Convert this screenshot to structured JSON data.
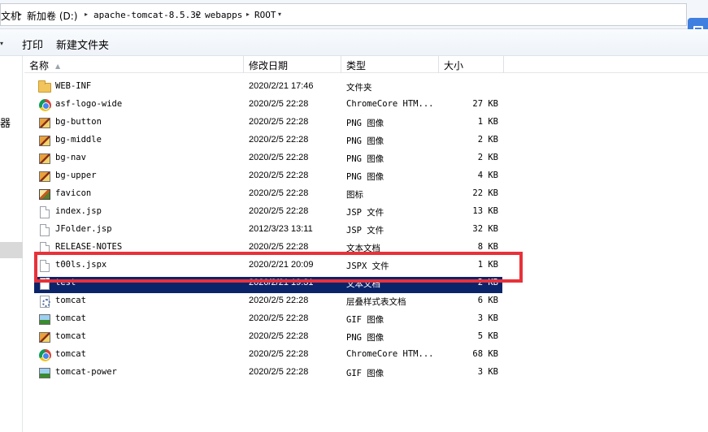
{
  "breadcrumb": {
    "items": [
      "文机",
      "新加卷 (D:)",
      "apache-tomcat-8.5.32",
      "webapps",
      "ROOT"
    ]
  },
  "toolbar": {
    "print_label": "打印",
    "new_folder_label": "新建文件夹"
  },
  "nav_pane": {
    "partial_char": "器"
  },
  "columns": {
    "name": "名称",
    "date": "修改日期",
    "type": "类型",
    "size": "大小"
  },
  "files": [
    {
      "name": "WEB-INF",
      "date": "2020/2/21 17:46",
      "type": "文件夹",
      "size": "",
      "icon": "folder-icon"
    },
    {
      "name": "asf-logo-wide",
      "date": "2020/2/5 22:28",
      "type": "ChromeCore HTM...",
      "size": "27 KB",
      "icon": "chrome-icon"
    },
    {
      "name": "bg-button",
      "date": "2020/2/5 22:28",
      "type": "PNG 图像",
      "size": "1 KB",
      "icon": "png-image-icon"
    },
    {
      "name": "bg-middle",
      "date": "2020/2/5 22:28",
      "type": "PNG 图像",
      "size": "2 KB",
      "icon": "png-image-icon"
    },
    {
      "name": "bg-nav",
      "date": "2020/2/5 22:28",
      "type": "PNG 图像",
      "size": "2 KB",
      "icon": "png-image-icon"
    },
    {
      "name": "bg-upper",
      "date": "2020/2/5 22:28",
      "type": "PNG 图像",
      "size": "4 KB",
      "icon": "png-image-icon"
    },
    {
      "name": "favicon",
      "date": "2020/2/5 22:28",
      "type": "图标",
      "size": "22 KB",
      "icon": "ico-icon"
    },
    {
      "name": "index.jsp",
      "date": "2020/2/5 22:28",
      "type": "JSP 文件",
      "size": "13 KB",
      "icon": "document-icon"
    },
    {
      "name": "JFolder.jsp",
      "date": "2012/3/23 13:11",
      "type": "JSP 文件",
      "size": "32 KB",
      "icon": "document-icon"
    },
    {
      "name": "RELEASE-NOTES",
      "date": "2020/2/5 22:28",
      "type": "文本文档",
      "size": "8 KB",
      "icon": "document-icon"
    },
    {
      "name": "t00ls.jspx",
      "date": "2020/2/21 20:09",
      "type": "JSPX 文件",
      "size": "1 KB",
      "icon": "document-icon"
    },
    {
      "name": "test",
      "date": "2020/2/21 19:31",
      "type": "文本文档",
      "size": "2 KB",
      "icon": "document-icon",
      "selected": true
    },
    {
      "name": "tomcat",
      "date": "2020/2/5 22:28",
      "type": "层叠样式表文档",
      "size": "6 KB",
      "icon": "css-icon"
    },
    {
      "name": "tomcat",
      "date": "2020/2/5 22:28",
      "type": "GIF 图像",
      "size": "3 KB",
      "icon": "gif-image-icon"
    },
    {
      "name": "tomcat",
      "date": "2020/2/5 22:28",
      "type": "PNG 图像",
      "size": "5 KB",
      "icon": "png-image-icon"
    },
    {
      "name": "tomcat",
      "date": "2020/2/5 22:28",
      "type": "ChromeCore HTM...",
      "size": "68 KB",
      "icon": "chrome-icon"
    },
    {
      "name": "tomcat-power",
      "date": "2020/2/5 22:28",
      "type": "GIF 图像",
      "size": "3 KB",
      "icon": "gif-image-icon"
    }
  ],
  "colors": {
    "selection": "#0a246a",
    "highlight_box": "#e8313a",
    "accent_button": "#3e7fe0"
  }
}
